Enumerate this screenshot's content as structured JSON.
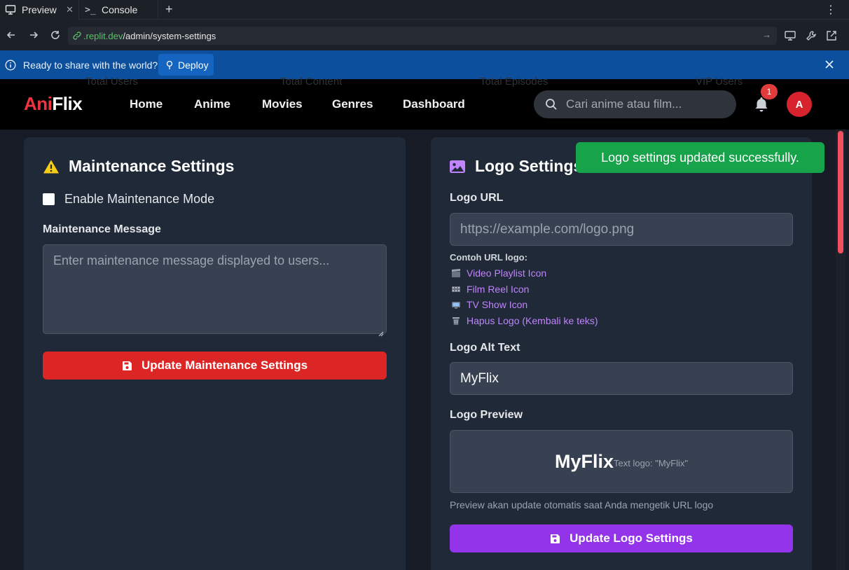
{
  "browser": {
    "tabs": [
      {
        "label": "Preview",
        "icon": "monitor-icon"
      },
      {
        "label": "Console",
        "icon": "terminal-icon"
      }
    ],
    "url_domain": ".replit.dev",
    "url_path": "/admin/system-settings"
  },
  "deploy_bar": {
    "message": "Ready to share with the world?",
    "button_label": "Deploy"
  },
  "app": {
    "logo_part1": "Ani",
    "logo_part2": "Flix",
    "nav": [
      "Home",
      "Anime",
      "Movies",
      "Genres",
      "Dashboard"
    ],
    "search_placeholder": "Cari anime atau film...",
    "notification_count": "1",
    "avatar_initial": "A",
    "background_stats": [
      "Total Users",
      "Total Content",
      "Total Episodes",
      "VIP Users"
    ]
  },
  "maintenance": {
    "title": "Maintenance Settings",
    "checkbox_label": "Enable Maintenance Mode",
    "checked": false,
    "message_label": "Maintenance Message",
    "message_placeholder": "Enter maintenance message displayed to users...",
    "button_label": "Update Maintenance Settings"
  },
  "logo_settings": {
    "title": "Logo Settings",
    "url_label": "Logo URL",
    "url_placeholder": "https://example.com/logo.png",
    "examples_title": "Contoh URL logo:",
    "examples": [
      {
        "label": "Video Playlist Icon",
        "icon": "clapperboard-icon"
      },
      {
        "label": "Film Reel Icon",
        "icon": "film-icon"
      },
      {
        "label": "TV Show Icon",
        "icon": "tv-icon"
      },
      {
        "label": "Hapus Logo (Kembali ke teks)",
        "icon": "trash-icon"
      }
    ],
    "alt_label": "Logo Alt Text",
    "alt_value": "MyFlix",
    "preview_label": "Logo Preview",
    "preview_text": "MyFlix",
    "preview_note": "Text logo: \"MyFlix\"",
    "hint": "Preview akan update otomatis saat Anda mengetik URL logo",
    "button_label": "Update Logo Settings"
  },
  "toast": {
    "message": "Logo settings updated successfully."
  },
  "colors": {
    "brand_red": "#ef3340",
    "maintenance_button": "#dc2626",
    "logo_button": "#9333ea",
    "toast_green": "#16a34a",
    "link_purple": "#c084fc"
  }
}
